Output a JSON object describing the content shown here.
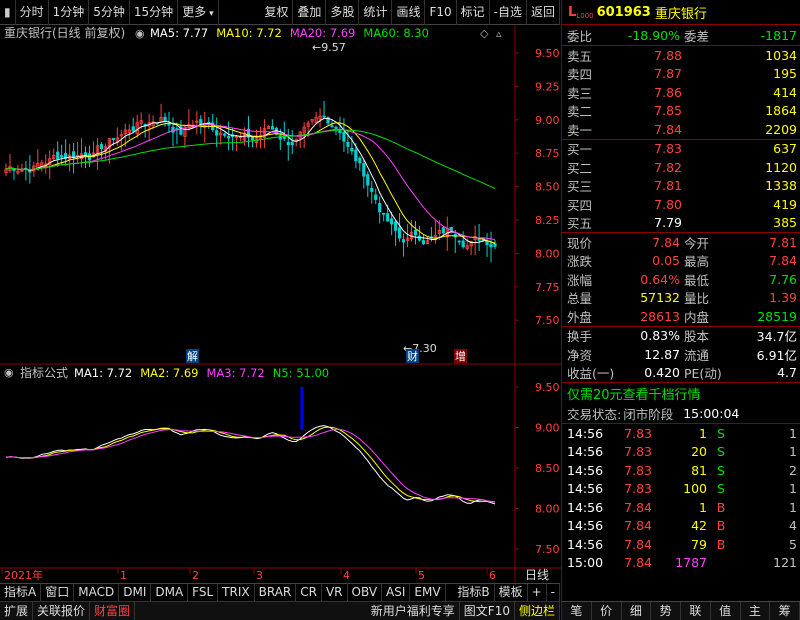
{
  "toolbar": {
    "left": [
      "分时",
      "1分钟",
      "5分钟",
      "15分钟",
      "更多"
    ],
    "right": [
      "复权",
      "叠加",
      "多股",
      "统计",
      "画线",
      "F10",
      "标记",
      "-自选",
      "返回"
    ]
  },
  "main_chart": {
    "title": "重庆银行(日线 前复权)",
    "ma_labels": [
      {
        "text": "MA5: 7.77",
        "color": "#ffffff"
      },
      {
        "text": "MA10: 7.72",
        "color": "#ffff00"
      },
      {
        "text": "MA20: 7.69",
        "color": "#ff40ff"
      },
      {
        "text": "MA60: 8.30",
        "color": "#00e000"
      }
    ],
    "ticks": [
      "9.50",
      "9.25",
      "9.00",
      "8.75",
      "8.50",
      "8.25",
      "8.00",
      "7.75",
      "7.50"
    ],
    "tick_values": [
      9.5,
      9.25,
      9.0,
      8.75,
      8.5,
      8.25,
      8.0,
      7.75,
      7.5
    ],
    "high_label": "9.57",
    "low_label": "7.30",
    "markers": [
      "解",
      "财",
      "增"
    ]
  },
  "sub_chart": {
    "title": "指标公式",
    "ma_labels": [
      {
        "text": "MA1: 7.72",
        "color": "#ffffff"
      },
      {
        "text": "MA2: 7.69",
        "color": "#ffff00"
      },
      {
        "text": "MA3: 7.72",
        "color": "#ff40ff"
      },
      {
        "text": "N5: 51.00",
        "color": "#00e000"
      }
    ],
    "ticks": [
      "9.50",
      "9.00",
      "8.50",
      "8.00",
      "7.50"
    ],
    "tick_values": [
      9.5,
      9.0,
      8.5,
      8.0,
      7.5
    ]
  },
  "time_axis": {
    "labels": [
      "2021年",
      "1",
      "2",
      "3",
      "4",
      "5",
      "6"
    ],
    "period": "日线"
  },
  "bottom_tabs": [
    "指标A",
    "窗口",
    "MACD",
    "DMI",
    "DMA",
    "FSL",
    "TRIX",
    "BRAR",
    "CR",
    "VR",
    "OBV",
    "ASI",
    "EMV"
  ],
  "bottom_tabs_right": [
    "指标B",
    "模板",
    "+",
    "-"
  ],
  "bottom_bar2": [
    "扩展",
    "关联报价",
    "财富圈"
  ],
  "bottom_bar2_right": [
    "新用户福利专享",
    "图文F10",
    "侧边栏"
  ],
  "stock": {
    "code": "601963",
    "name": "重庆银行",
    "prefix": "L",
    "sup": "L000"
  },
  "weibi": {
    "label1": "委比",
    "value1": "-18.90%",
    "label2": "委差",
    "value2": "-1817"
  },
  "asks": [
    {
      "label": "卖五",
      "price": "7.88",
      "vol": "1034"
    },
    {
      "label": "卖四",
      "price": "7.87",
      "vol": "195"
    },
    {
      "label": "卖三",
      "price": "7.86",
      "vol": "414"
    },
    {
      "label": "卖二",
      "price": "7.85",
      "vol": "1864"
    },
    {
      "label": "卖一",
      "price": "7.84",
      "vol": "2209"
    }
  ],
  "bids": [
    {
      "label": "买一",
      "price": "7.83",
      "vol": "637"
    },
    {
      "label": "买二",
      "price": "7.82",
      "vol": "1120"
    },
    {
      "label": "买三",
      "price": "7.81",
      "vol": "1338"
    },
    {
      "label": "买四",
      "price": "7.80",
      "vol": "419"
    },
    {
      "label": "买五",
      "price": "7.79",
      "vol": "385"
    }
  ],
  "quote": [
    {
      "l1": "现价",
      "v1": "7.84",
      "c1": "#ff4040",
      "l2": "今开",
      "v2": "7.81",
      "c2": "#ff4040"
    },
    {
      "l1": "涨跌",
      "v1": "0.05",
      "c1": "#ff4040",
      "l2": "最高",
      "v2": "7.84",
      "c2": "#ff4040"
    },
    {
      "l1": "涨幅",
      "v1": "0.64%",
      "c1": "#ff4040",
      "l2": "最低",
      "v2": "7.76",
      "c2": "#00e000"
    },
    {
      "l1": "总量",
      "v1": "57132",
      "c1": "#ffff00",
      "l2": "量比",
      "v2": "1.39",
      "c2": "#ff4040"
    },
    {
      "l1": "外盘",
      "v1": "28613",
      "c1": "#ff4040",
      "l2": "内盘",
      "v2": "28519",
      "c2": "#00e000"
    }
  ],
  "stats": [
    {
      "l1": "换手",
      "v1": "0.83%",
      "l2": "股本",
      "v2": "34.7亿"
    },
    {
      "l1": "净资",
      "v1": "12.87",
      "l2": "流通",
      "v2": "6.91亿"
    },
    {
      "l1": "收益(一)",
      "v1": "0.420",
      "l2": "PE(动)",
      "v2": "4.7"
    }
  ],
  "promo": "仅需20元查看千档行情",
  "status": {
    "label": "交易状态:",
    "value": "闭市阶段",
    "time": "15:00:04"
  },
  "trades": [
    {
      "t": "14:56",
      "p": "7.83",
      "v": "1",
      "d": "S",
      "n": "1"
    },
    {
      "t": "14:56",
      "p": "7.83",
      "v": "20",
      "d": "S",
      "n": "1"
    },
    {
      "t": "14:56",
      "p": "7.83",
      "v": "81",
      "d": "S",
      "n": "2"
    },
    {
      "t": "14:56",
      "p": "7.83",
      "v": "100",
      "d": "S",
      "n": "1"
    },
    {
      "t": "14:56",
      "p": "7.84",
      "v": "1",
      "d": "B",
      "n": "1"
    },
    {
      "t": "14:56",
      "p": "7.84",
      "v": "42",
      "d": "B",
      "n": "4"
    },
    {
      "t": "14:56",
      "p": "7.84",
      "v": "79",
      "d": "B",
      "n": "5"
    },
    {
      "t": "15:00",
      "p": "7.84",
      "v": "1787",
      "d": "",
      "n": "121"
    }
  ],
  "right_tabs": [
    "笔",
    "价",
    "细",
    "势",
    "联",
    "值",
    "主",
    "筹"
  ],
  "colors": {
    "up": "#ff4040",
    "down": "#00e000",
    "ma5": "#ffffff",
    "ma10": "#ffff00",
    "ma20": "#ff40ff",
    "ma60": "#00e000",
    "frame": "#8b0000"
  }
}
